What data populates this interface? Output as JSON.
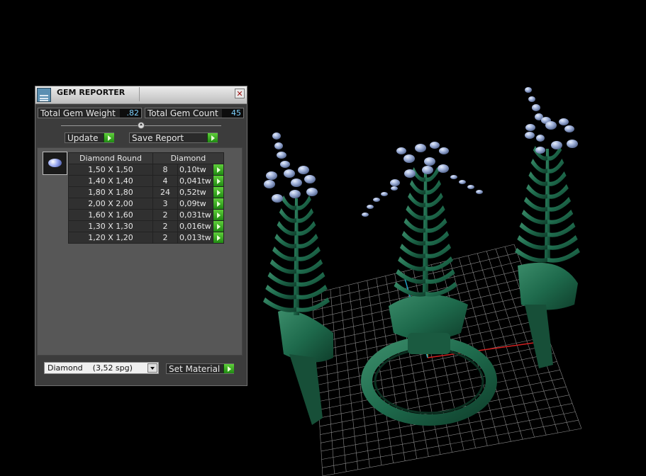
{
  "window": {
    "title": "GEM REPORTER",
    "close_glyph": "✕"
  },
  "stats": {
    "weight_label": "Total Gem Weight",
    "weight_value": ".82",
    "count_label": "Total Gem Count",
    "count_value": "45"
  },
  "actions": {
    "update_label": "Update",
    "save_report_label": "Save Report",
    "set_material_label": "Set Material"
  },
  "table": {
    "headers": [
      "Diamond Round",
      "Diamond"
    ],
    "rows": [
      {
        "size": "1,50 X 1,50",
        "count": "8",
        "weight": "0,10tw"
      },
      {
        "size": "1,40 X 1,40",
        "count": "4",
        "weight": "0,041tw"
      },
      {
        "size": "1,80 X 1,80",
        "count": "24",
        "weight": "0,52tw"
      },
      {
        "size": "2,00 X 2,00",
        "count": "3",
        "weight": "0,09tw"
      },
      {
        "size": "1,60 X 1,60",
        "count": "2",
        "weight": "0,031tw"
      },
      {
        "size": "1,30 X 1,30",
        "count": "2",
        "weight": "0,016tw"
      },
      {
        "size": "1,20 X 1,20",
        "count": "2",
        "weight": "0,013tw"
      }
    ]
  },
  "material": {
    "selected": "Diamond    (3,52 spg)"
  },
  "icons": {
    "app": "gem-reporter-icon",
    "gem": "round-diamond-icon",
    "arrow": "green-arrow-icon",
    "dropdown": "chevron-down-icon"
  },
  "colors": {
    "metal": "#1e6a4c",
    "gems": "#9fb0d8",
    "grid": "#8a8a8a",
    "panel": "#3c3c3c",
    "value_text": "#7fd3ff",
    "arrow_button": "#2fa81e"
  }
}
